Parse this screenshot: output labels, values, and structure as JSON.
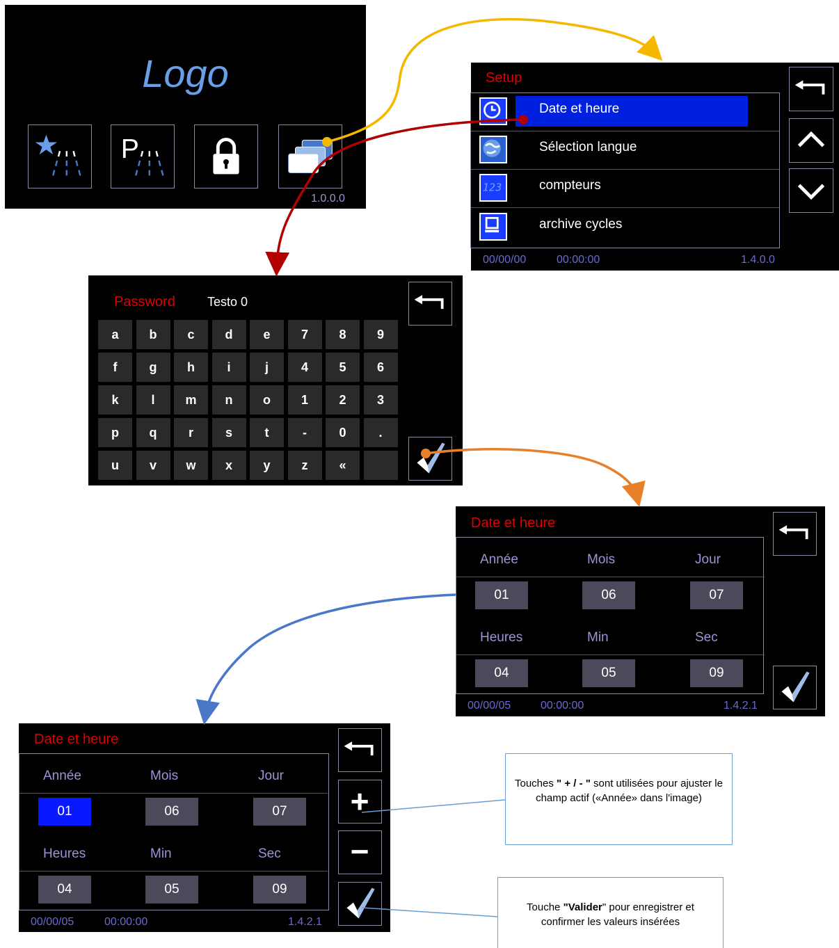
{
  "home": {
    "logo": "Logo",
    "version": "1.0.0.0",
    "icons": [
      "favorite-program-icon",
      "program-p-icon",
      "lock-icon",
      "setup-windows-icon"
    ]
  },
  "setup": {
    "title": "Setup",
    "items": [
      {
        "label": "Date et heure",
        "icon": "clock-icon"
      },
      {
        "label": "Sélection langue",
        "icon": "globe-icon"
      },
      {
        "label": "compteurs",
        "icon": "counter-123-icon"
      },
      {
        "label": "archive cycles",
        "icon": "archive-icon"
      }
    ],
    "status_date": "00/00/00",
    "status_time": "00:00:00",
    "version": "1.4.0.0"
  },
  "password": {
    "title": "Password",
    "value": "Testo 0",
    "keys": [
      [
        "a",
        "b",
        "c",
        "d",
        "e",
        "7",
        "8",
        "9"
      ],
      [
        "f",
        "g",
        "h",
        "i",
        "j",
        "4",
        "5",
        "6"
      ],
      [
        "k",
        "l",
        "m",
        "n",
        "o",
        "1",
        "2",
        "3"
      ],
      [
        "p",
        "q",
        "r",
        "s",
        "t",
        "-",
        "0",
        "."
      ],
      [
        "u",
        "v",
        "w",
        "x",
        "y",
        "z",
        "«",
        ""
      ]
    ]
  },
  "datetime1": {
    "title": "Date et heure",
    "labels_top": [
      "Année",
      "Mois",
      "Jour"
    ],
    "values_top": [
      "01",
      "06",
      "07"
    ],
    "labels_bottom": [
      "Heures",
      "Min",
      "Sec"
    ],
    "values_bottom": [
      "04",
      "05",
      "09"
    ],
    "status_date": "00/00/05",
    "status_time": "00:00:00",
    "version": "1.4.2.1"
  },
  "datetime2": {
    "title": "Date et heure",
    "labels_top": [
      "Année",
      "Mois",
      "Jour"
    ],
    "values_top": [
      "01",
      "06",
      "07"
    ],
    "labels_bottom": [
      "Heures",
      "Min",
      "Sec"
    ],
    "values_bottom": [
      "04",
      "05",
      "09"
    ],
    "status_date": "00/00/05",
    "status_time": "00:00:00",
    "version": "1.4.2.1",
    "plus": "+",
    "minus": "−"
  },
  "callouts": {
    "plus_minus": {
      "pre": "Touches ",
      "bold": "\" + / - \"",
      "post": " sont utilisées pour ajuster le champ actif («Année» dans l'image)"
    },
    "validate": {
      "pre": "Touche ",
      "bold": "\"Valider",
      "post": "\" pour enregistrer et confirmer les valeurs insérées"
    }
  },
  "colors": {
    "flow_yellow": "#f5b800",
    "flow_red": "#b00000",
    "flow_orange": "#e8802a",
    "flow_blue": "#4a78c8",
    "callout_border": "#6b9fd4"
  }
}
